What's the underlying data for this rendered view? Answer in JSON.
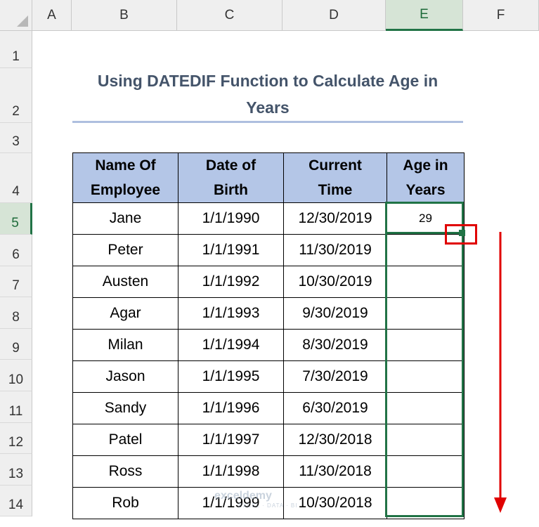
{
  "column_headers": [
    "A",
    "B",
    "C",
    "D",
    "E",
    "F"
  ],
  "row_headers": [
    "1",
    "2",
    "3",
    "4",
    "5",
    "6",
    "7",
    "8",
    "9",
    "10",
    "11",
    "12",
    "13",
    "14"
  ],
  "selected_column": "E",
  "selected_row": "5",
  "title": {
    "line1": "Using DATEDIF Function to Calculate Age in",
    "line2": "Years"
  },
  "table": {
    "headers": [
      {
        "line1": "Name Of",
        "line2": "Employee"
      },
      {
        "line1": "Date of",
        "line2": "Birth"
      },
      {
        "line1": "Current",
        "line2": "Time"
      },
      {
        "line1": "Age in",
        "line2": "Years"
      }
    ],
    "rows": [
      {
        "name": "Jane",
        "dob": "1/1/1990",
        "current": "12/30/2019",
        "age": "29"
      },
      {
        "name": "Peter",
        "dob": "1/1/1991",
        "current": "11/30/2019",
        "age": ""
      },
      {
        "name": "Austen",
        "dob": "1/1/1992",
        "current": "10/30/2019",
        "age": ""
      },
      {
        "name": "Agar",
        "dob": "1/1/1993",
        "current": "9/30/2019",
        "age": ""
      },
      {
        "name": "Milan",
        "dob": "1/1/1994",
        "current": "8/30/2019",
        "age": ""
      },
      {
        "name": "Jason",
        "dob": "1/1/1995",
        "current": "7/30/2019",
        "age": ""
      },
      {
        "name": "Sandy",
        "dob": "1/1/1996",
        "current": "6/30/2019",
        "age": ""
      },
      {
        "name": "Patel",
        "dob": "1/1/1997",
        "current": "12/30/2018",
        "age": ""
      },
      {
        "name": "Ross",
        "dob": "1/1/1998",
        "current": "11/30/2018",
        "age": ""
      },
      {
        "name": "Rob",
        "dob": "1/1/1999",
        "current": "10/30/2018",
        "age": ""
      }
    ]
  },
  "watermark": {
    "brand": "exceldemy",
    "tagline": "EXCEL · DATA · BI"
  },
  "colors": {
    "header_fill": "#b4c6e7",
    "title_text": "#44546a",
    "selection": "#217346",
    "annotation": "#e00000"
  }
}
